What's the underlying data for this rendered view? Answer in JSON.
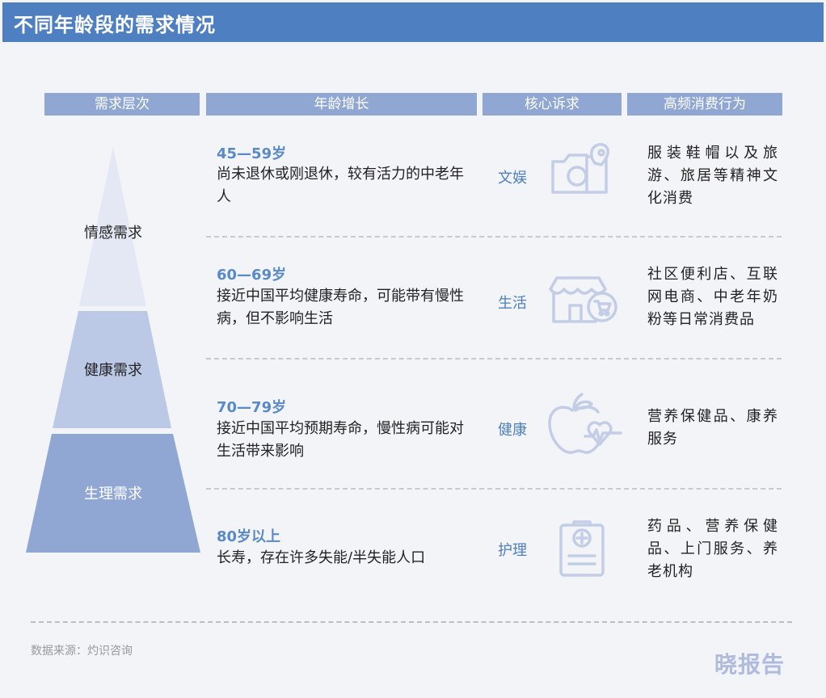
{
  "title": "不同年龄段的需求情况",
  "headers": {
    "col1": "需求层次",
    "col2": "年龄增长",
    "col3": "核心诉求",
    "col4": "高频消费行为"
  },
  "pyramid": {
    "top_label": "情感需求",
    "mid_label": "健康需求",
    "bottom_label": "生理需求",
    "colors": {
      "top": "#e3e8f4",
      "mid": "#bcc9e6",
      "bottom": "#8fa7d2"
    }
  },
  "rows": [
    {
      "age": "45—59岁",
      "description": "尚未退休或刚退休，较有活力的中老年人",
      "core": "文娱",
      "icon": "camera-location-icon",
      "behavior": "服装鞋帽以及旅游、旅居等精神文化消费"
    },
    {
      "age": "60—69岁",
      "description": "接近中国平均健康寿命，可能带有慢性病，但不影响生活",
      "core": "生活",
      "icon": "store-cart-icon",
      "behavior": "社区便利店、互联网电商、中老年奶粉等日常消费品"
    },
    {
      "age": "70—79岁",
      "description": "接近中国平均预期寿命，慢性病可能对生活带来影响",
      "core": "健康",
      "icon": "apple-heart-icon",
      "behavior": "营养保健品、康养服务"
    },
    {
      "age": "80岁以上",
      "description": "长寿，存在许多失能/半失能人口",
      "core": "护理",
      "icon": "medical-clipboard-icon",
      "behavior": "药品、营养保健品、上门服务、养老机构"
    }
  ],
  "source": "数据来源：灼识咨询",
  "brand": "晓报告",
  "colors": {
    "accent": "#4e7fc1",
    "header": "#8fa7d2",
    "icon": "#c3cde6"
  }
}
